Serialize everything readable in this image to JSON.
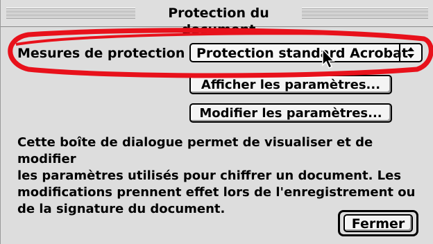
{
  "dialog": {
    "title": "Protection du document",
    "security_label": "Mesures de protection :",
    "security_method": {
      "selected": "Protection standard Acrobat",
      "arrow_icon": "updown-arrows-icon"
    },
    "show_settings_label": "Afficher les paramètres...",
    "change_settings_label": "Modifier les paramètres...",
    "description": "Cette boîte de dialogue permet de visualiser et de modifier\nles paramètres utilisés pour chiffrer un document. Les\nmodifications prennent effet lors de l'enregistrement ou\nde la signature du document.",
    "close_label": "Fermer"
  },
  "colors": {
    "window_bg": "#dddddd",
    "highlight": "#e8111b"
  }
}
